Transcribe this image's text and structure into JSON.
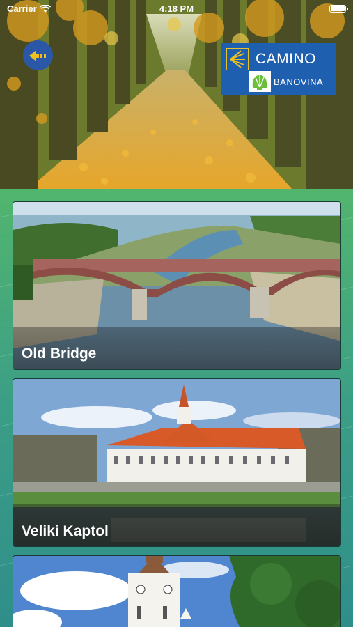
{
  "status": {
    "carrier": "Carrier",
    "time": "4:18 PM"
  },
  "header": {
    "logo_title": "CAMINO",
    "logo_subtitle": "BANOVINA"
  },
  "places": [
    {
      "title": "Old Bridge"
    },
    {
      "title": "Veliki Kaptol"
    },
    {
      "title": ""
    }
  ],
  "icons": [
    "wifi-icon",
    "battery-icon",
    "back-arrow-icon",
    "scallop-shell-icon"
  ],
  "colors": {
    "primary_blue": "#1f5fb0",
    "back_button": "#2a58a6",
    "shell_yellow": "#f0c020",
    "background_green": "#3d9a6e"
  }
}
